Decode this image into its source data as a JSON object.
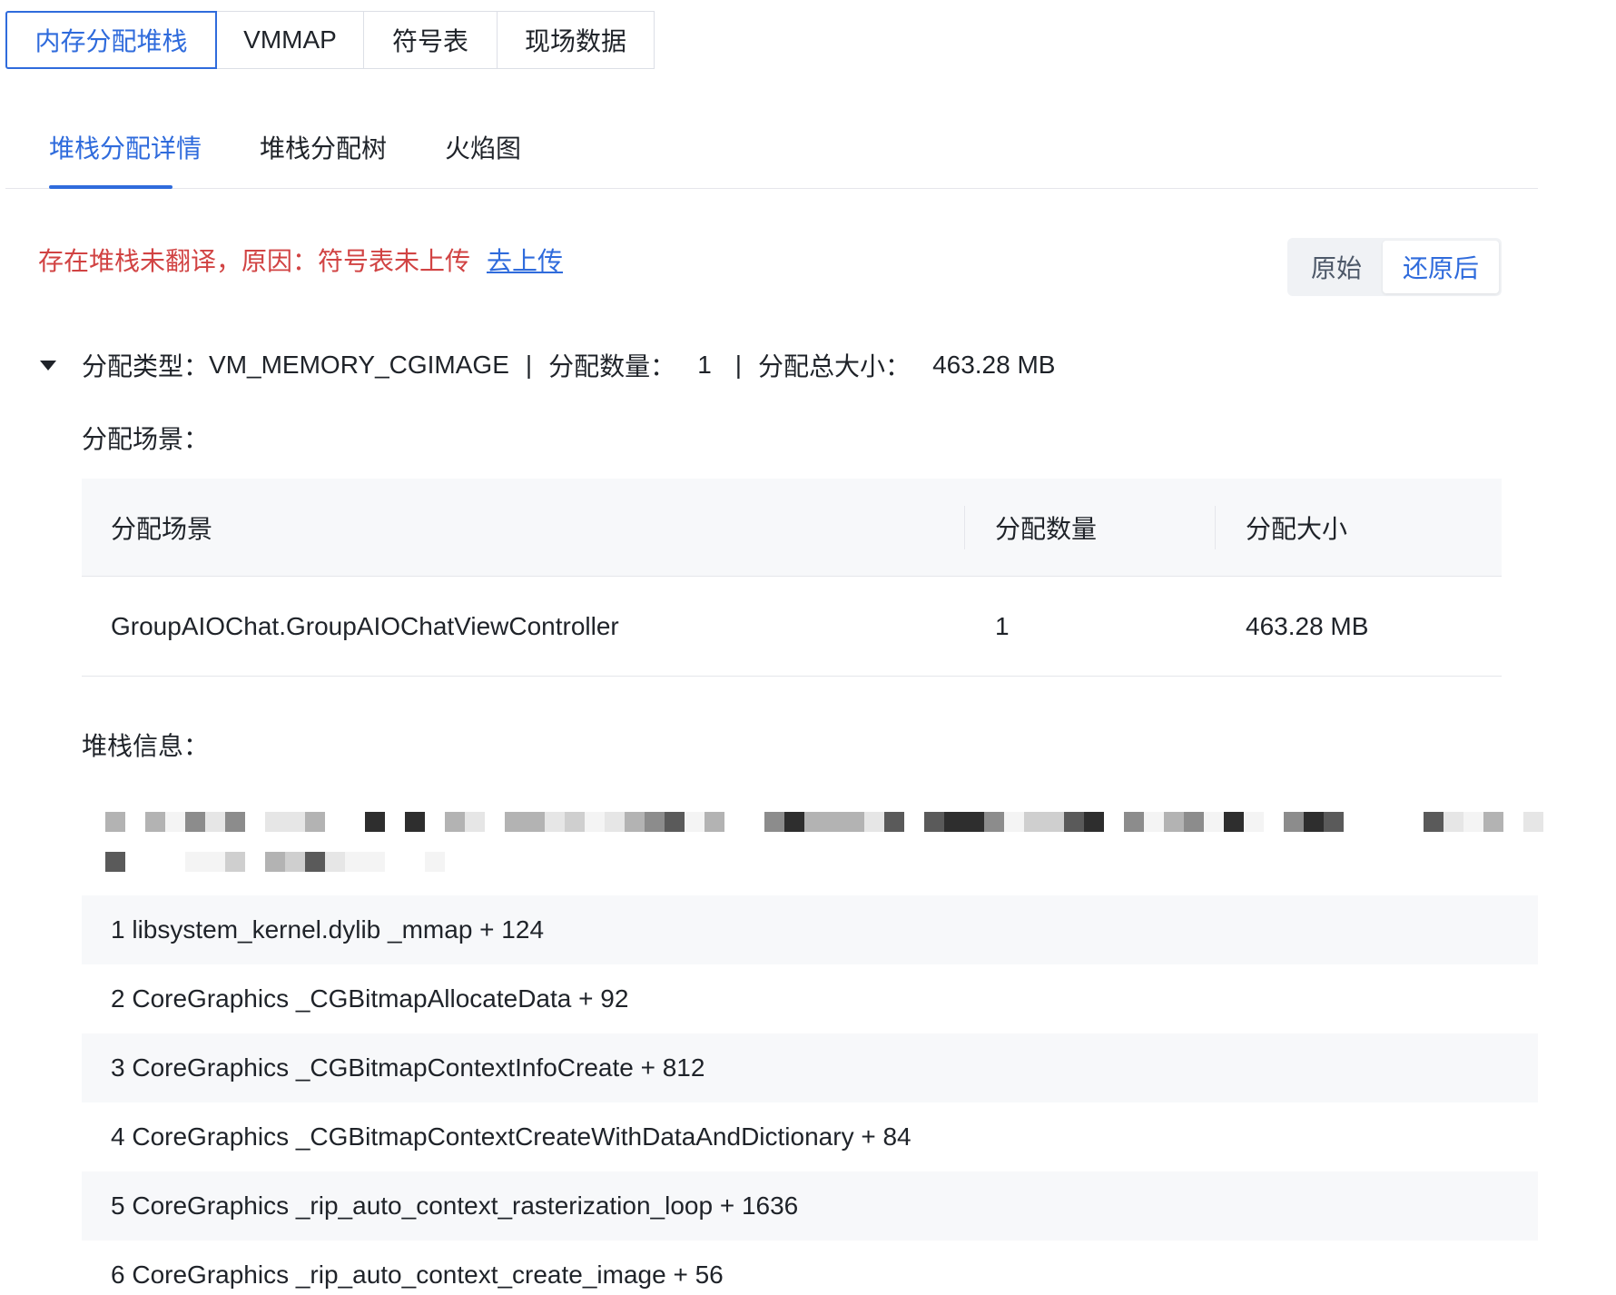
{
  "top_tabs": [
    {
      "label": "内存分配堆栈",
      "active": true
    },
    {
      "label": "VMMAP",
      "active": false
    },
    {
      "label": "符号表",
      "active": false
    },
    {
      "label": "现场数据",
      "active": false
    }
  ],
  "sub_tabs": [
    {
      "label": "堆栈分配详情",
      "active": true
    },
    {
      "label": "堆栈分配树",
      "active": false
    },
    {
      "label": "火焰图",
      "active": false
    }
  ],
  "warning": {
    "text": "存在堆栈未翻译，原因：符号表未上传",
    "link": "去上传"
  },
  "view_toggle": {
    "original": "原始",
    "restored": "还原后",
    "selected": "还原后"
  },
  "allocation": {
    "type_label": "分配类型：",
    "type_value": "VM_MEMORY_CGIMAGE",
    "count_label": "分配数量：",
    "count_value": "1",
    "size_label": "分配总大小：",
    "size_value": "463.28 MB",
    "separator": "|"
  },
  "scene_section_label": "分配场景：",
  "scene_table": {
    "headers": [
      "分配场景",
      "分配数量",
      "分配大小"
    ],
    "rows": [
      {
        "scene": "GroupAIOChat.GroupAIOChatViewController",
        "count": "1",
        "size": "463.28 MB"
      }
    ]
  },
  "stack_section_label": "堆栈信息：",
  "stack_frames": [
    "1 libsystem_kernel.dylib _mmap +  124",
    "2 CoreGraphics _CGBitmapAllocateData +  92",
    "3 CoreGraphics _CGBitmapContextInfoCreate +  812",
    "4 CoreGraphics _CGBitmapContextCreateWithDataAndDictionary +  84",
    "5 CoreGraphics _rip_auto_context_rasterization_loop +  1636",
    "6 CoreGraphics _rip_auto_context_create_image +  56"
  ],
  "colors": {
    "accent": "#2f6bdc",
    "warning": "#d14343",
    "row_alt": "#f7f8fa",
    "border": "#e5e6eb"
  }
}
